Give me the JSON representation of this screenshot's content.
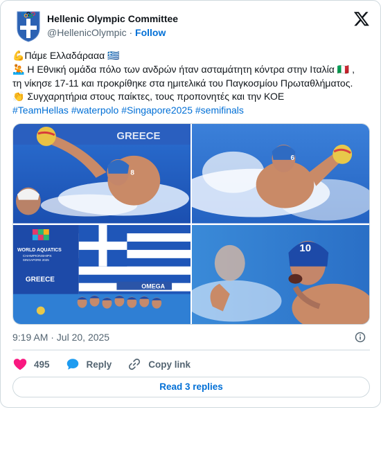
{
  "author": {
    "name": "Hellenic Olympic Committee",
    "handle": "@HellenicOlympic",
    "separator": "·",
    "follow_label": "Follow",
    "avatar_icon": "hoc-shield-logo-icon"
  },
  "platform_icon": "x-logo-icon",
  "tweet": {
    "line1_emoji": "💪",
    "line1_text": "Πάμε Ελλαδάρααα",
    "line1_flag": "🇬🇷",
    "line2_emoji": "🤽",
    "line2_text": "Η Εθνική ομάδα πόλο των ανδρών ήταν ασταμάτητη κόντρα στην Ιταλία",
    "line2_flag": "🇮🇹",
    "line2_tail": ",",
    "line3_text": "τη νίκησε 17-11 και προκρίθηκε στα ημιτελικά του Παγκοσμίου Πρωταθλήματος.",
    "line4_emoji": "👏",
    "line4_text": "Συγχαρητήρια στους παίκτες, τους προπονητές και την ΚΟΕ",
    "hashtags": [
      "#TeamHellas",
      "#waterpolo",
      "#Singapore2025",
      "#semifinals"
    ]
  },
  "media": {
    "photos": [
      {
        "name": "photo-player-8-shooting",
        "cap_number": "8",
        "banner_text": "GREECE"
      },
      {
        "name": "photo-player-6-throwing",
        "cap_number": "6"
      },
      {
        "name": "photo-greek-flag-team",
        "wa_title": "WORLD AQUATICS",
        "wa_sub": "CHAMPIONSHIPS",
        "wa_loc": "SINGAPORE 2025",
        "country": "GREECE",
        "sponsor": "OMEGA"
      },
      {
        "name": "photo-player-10-celebrating",
        "cap_number": "10"
      }
    ]
  },
  "timestamp": "9:19 AM · Jul 20, 2025",
  "actions": {
    "like_count": "495",
    "reply_label": "Reply",
    "copy_label": "Copy link"
  },
  "read_replies_label": "Read 3 replies",
  "colors": {
    "link": "#006fd6",
    "like": "#f91880",
    "reply": "#1d9bf0",
    "secondary_text": "#536471",
    "border": "#cfd9de"
  }
}
